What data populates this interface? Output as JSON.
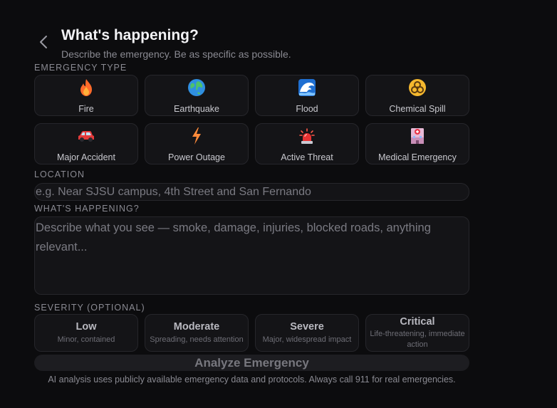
{
  "header": {
    "back_icon": "chevron-left-icon",
    "title": "What's happening?",
    "subtitle": "Describe the emergency. Be as specific as possible."
  },
  "emergency_type": {
    "label": "EMERGENCY TYPE",
    "items": [
      {
        "label": "Fire",
        "icon": "fire-icon"
      },
      {
        "label": "Earthquake",
        "icon": "globe-icon"
      },
      {
        "label": "Flood",
        "icon": "wave-icon"
      },
      {
        "label": "Chemical Spill",
        "icon": "biohazard-icon"
      },
      {
        "label": "Major Accident",
        "icon": "car-icon"
      },
      {
        "label": "Power Outage",
        "icon": "lightning-icon"
      },
      {
        "label": "Active Threat",
        "icon": "siren-icon"
      },
      {
        "label": "Medical Emergency",
        "icon": "hospital-icon"
      }
    ]
  },
  "location": {
    "label": "LOCATION",
    "placeholder": "e.g. Near SJSU campus, 4th Street and San Fernando"
  },
  "description": {
    "label": "WHAT'S HAPPENING?",
    "placeholder": "Describe what you see — smoke, damage, injuries, blocked roads, anything relevant..."
  },
  "severity": {
    "label": "SEVERITY (OPTIONAL)",
    "items": [
      {
        "name": "Low",
        "desc": "Minor, contained"
      },
      {
        "name": "Moderate",
        "desc": "Spreading, needs attention"
      },
      {
        "name": "Severe",
        "desc": "Major, widespread impact"
      },
      {
        "name": "Critical",
        "desc": "Life-threatening, immediate action"
      }
    ]
  },
  "analyze_button": {
    "label": "Analyze Emergency"
  },
  "footnote": "AI analysis uses publicly available emergency data and protocols. Always call 911 for real emergencies.",
  "colors": {
    "background": "#0c0c0e",
    "card": "#141417",
    "border": "#26262b",
    "fire": "#ff6a2a",
    "power": "#ff8a3a"
  }
}
